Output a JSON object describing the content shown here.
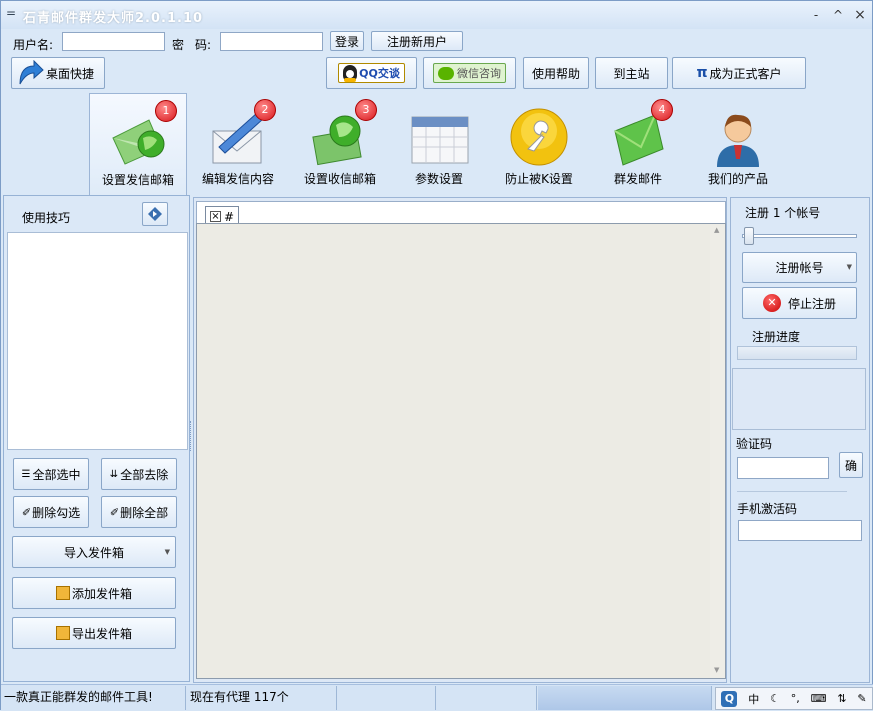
{
  "window": {
    "title": "石青邮件群发大师2.0.1.10",
    "minimize": "-",
    "maximize": "^",
    "close": "×",
    "sysmenu": "="
  },
  "login": {
    "username_label": "用户名:",
    "password_label1": "密",
    "password_label2": "码:",
    "login_button": "登录",
    "register_button": "注册新用户",
    "username_value": "",
    "password_value": ""
  },
  "toolbar": {
    "desktop_shortcut": "桌面快捷",
    "qq_chat": "QQ交谈",
    "wechat": "微信咨询",
    "help": "使用帮助",
    "home": "到主站",
    "become_customer_pi": "π",
    "become_customer": "成为正式客户"
  },
  "nav": [
    {
      "label": "设置发信邮箱",
      "badge": "1",
      "icon": "globe-envelope-icon"
    },
    {
      "label": "编辑发信内容",
      "badge": "2",
      "icon": "envelope-pen-icon"
    },
    {
      "label": "设置收信邮箱",
      "badge": "3",
      "icon": "globe-card-icon"
    },
    {
      "label": "参数设置",
      "badge": "",
      "icon": "calendar-icon"
    },
    {
      "label": "防止被K设置",
      "badge": "",
      "icon": "wrench-icon"
    },
    {
      "label": "群发邮件",
      "badge": "4",
      "icon": "green-envelope-icon"
    },
    {
      "label": "我们的产品",
      "badge": "",
      "icon": "person-icon"
    }
  ],
  "left": {
    "tips_label": "使用技巧",
    "select_all": "全部选中",
    "remove_all": "全部去除",
    "delete_checked": "删除勾选",
    "delete_all": "删除全部",
    "import": "导入发件箱",
    "add": "添加发件箱",
    "export": "导出发件箱"
  },
  "center": {
    "tab_close": "×",
    "tab_label": "#"
  },
  "right": {
    "register_count": "注册 1 个帐号",
    "register_button": "注册帐号",
    "stop_button": "停止注册",
    "progress_label": "注册进度",
    "progress": 0,
    "captcha_label": "验证码",
    "confirm_button": "确",
    "phone_label": "手机激活码",
    "captcha_value": "",
    "phone_value": ""
  },
  "status": {
    "slogan": "一款真正能群发的邮件工具!",
    "proxy": "现在有代理 117个"
  },
  "ime": {
    "items": [
      "中",
      "☾",
      "°,",
      "⌨",
      "⇅",
      "✎"
    ]
  },
  "colors": {
    "badge": "#d8171c",
    "accent": "#2f6fb6"
  }
}
